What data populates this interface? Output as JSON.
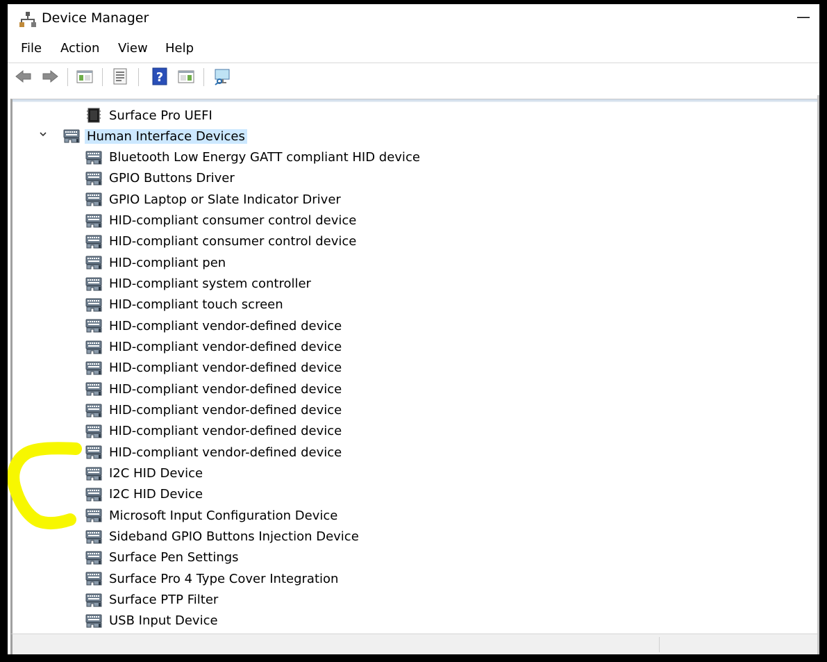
{
  "window": {
    "title": "Device Manager",
    "minimize_glyph": "—"
  },
  "menu": {
    "items": [
      "File",
      "Action",
      "View",
      "Help"
    ]
  },
  "toolbar": {
    "buttons": [
      "back-arrow-icon",
      "forward-arrow-icon",
      "show-hide-console-tree-icon",
      "properties-icon",
      "help-icon",
      "action-pane-icon",
      "scan-hardware-changes-icon"
    ]
  },
  "tree": {
    "above_item": "Surface Pro UEFI",
    "category": "Human Interface Devices",
    "devices": [
      "Bluetooth Low Energy GATT compliant HID device",
      "GPIO Buttons Driver",
      "GPIO Laptop or Slate Indicator Driver",
      "HID-compliant consumer control device",
      "HID-compliant consumer control device",
      "HID-compliant pen",
      "HID-compliant system controller",
      "HID-compliant touch screen",
      "HID-compliant vendor-defined device",
      "HID-compliant vendor-defined device",
      "HID-compliant vendor-defined device",
      "HID-compliant vendor-defined device",
      "HID-compliant vendor-defined device",
      "HID-compliant vendor-defined device",
      "HID-compliant vendor-defined device",
      "I2C HID Device",
      "I2C HID Device",
      "Microsoft Input Configuration Device",
      "Sideband GPIO Buttons Injection Device",
      "Surface Pen Settings",
      "Surface Pro 4 Type Cover Integration",
      "Surface PTP Filter",
      "USB Input Device"
    ]
  },
  "colors": {
    "selection": "#cce8ff",
    "highlighter": "#f7f700"
  }
}
